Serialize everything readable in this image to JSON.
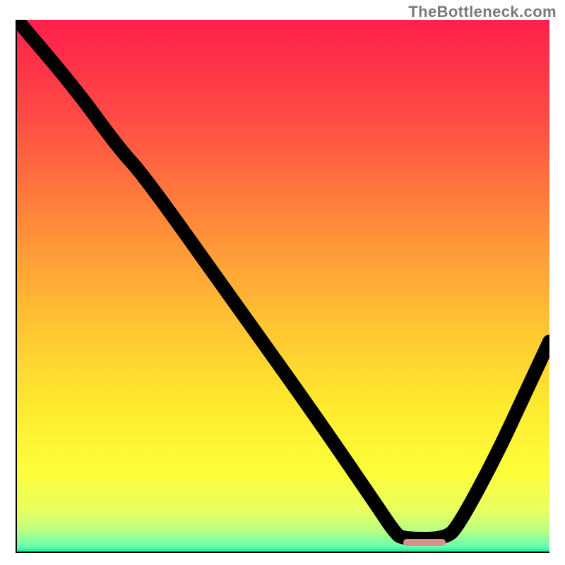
{
  "watermark": "TheBottleneck.com",
  "colors": {
    "gradient_top": "#ff1f4b",
    "gradient_mid": "#ffe92e",
    "gradient_bottom": "#10e886",
    "curve": "#000000",
    "marker": "#db8f8b",
    "axis": "#000000"
  },
  "marker": {
    "x_start_pct": 72.5,
    "x_end_pct": 80.5,
    "y_pct": 98.3
  },
  "chart_data": {
    "type": "line",
    "title": "",
    "xlabel": "",
    "ylabel": "",
    "xlim": [
      0,
      100
    ],
    "ylim": [
      0,
      100
    ],
    "note": "Axes and ticks are intentionally hidden in the source image; x and y are percentage of plot width/height with y=0 at top (so higher y_pct = lower visual position = better/green).",
    "series": [
      {
        "name": "bottleneck-curve",
        "points": [
          {
            "x_pct": 0.0,
            "y_pct": 0.0
          },
          {
            "x_pct": 11.0,
            "y_pct": 13.0
          },
          {
            "x_pct": 19.0,
            "y_pct": 24.0
          },
          {
            "x_pct": 24.0,
            "y_pct": 29.5
          },
          {
            "x_pct": 40.0,
            "y_pct": 52.0
          },
          {
            "x_pct": 55.0,
            "y_pct": 73.0
          },
          {
            "x_pct": 67.0,
            "y_pct": 90.5
          },
          {
            "x_pct": 71.0,
            "y_pct": 96.5
          },
          {
            "x_pct": 72.5,
            "y_pct": 97.6
          },
          {
            "x_pct": 80.5,
            "y_pct": 97.6
          },
          {
            "x_pct": 83.0,
            "y_pct": 95.0
          },
          {
            "x_pct": 90.0,
            "y_pct": 82.0
          },
          {
            "x_pct": 96.0,
            "y_pct": 69.0
          },
          {
            "x_pct": 100.0,
            "y_pct": 60.5
          }
        ]
      }
    ],
    "optimal_range_x_pct": [
      72.5,
      80.5
    ]
  }
}
